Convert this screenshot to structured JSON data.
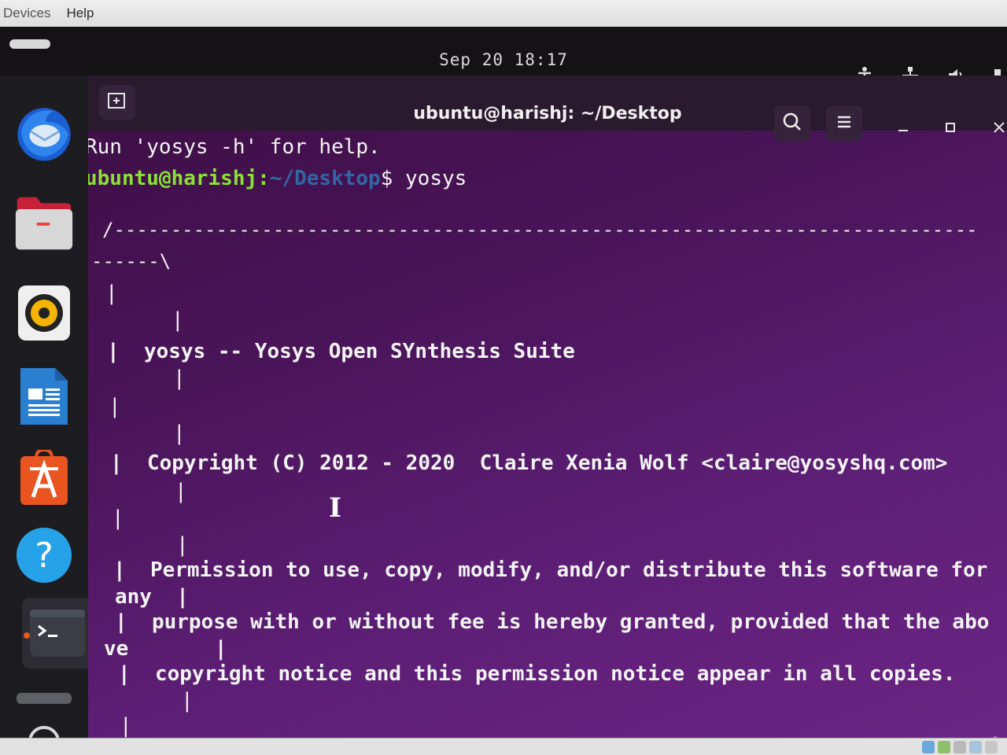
{
  "host_menu": {
    "items": [
      "Devices",
      "Help"
    ]
  },
  "topbar": {
    "clock": "Sep 20  18:17"
  },
  "dock": {
    "apps": [
      {
        "name": "thunderbird-icon"
      },
      {
        "name": "files-icon"
      },
      {
        "name": "rhythmbox-icon"
      },
      {
        "name": "libreoffice-writer-icon"
      },
      {
        "name": "software-center-icon"
      },
      {
        "name": "help-icon"
      },
      {
        "name": "terminal-icon",
        "active": true
      }
    ]
  },
  "terminal": {
    "title": "ubuntu@harishj: ~/Desktop",
    "lines": {
      "run_help": "Run 'yosys -h' for help.",
      "prompt_user": "ubuntu@harishj:",
      "prompt_path": "~/Desktop",
      "prompt_cmd": "$ yosys",
      "banner_top_1": "/----------------------------------------------------------------------------",
      "banner_top_2": "------\\",
      "pipe": "|",
      "suite_line": "|  yosys -- Yosys Open SYnthesis Suite",
      "copyright_line": "|  Copyright (C) 2012 - 2020  Claire Xenia Wolf <claire@yosyshq.com>",
      "perm_1": "|  Permission to use, copy, modify, and/or distribute this software for",
      "perm_1_wrap": "any  |",
      "perm_2": "|  purpose with or without fee is hereby granted, provided that the abo",
      "perm_2_wrap": "ve       |",
      "perm_3": "|  copyright notice and this permission notice appear in all copies."
    }
  },
  "colors": {
    "terminal_bg": "#4a1459",
    "prompt_user": "#8ae234",
    "prompt_path": "#3465a4",
    "ubuntu_orange": "#e95420"
  }
}
